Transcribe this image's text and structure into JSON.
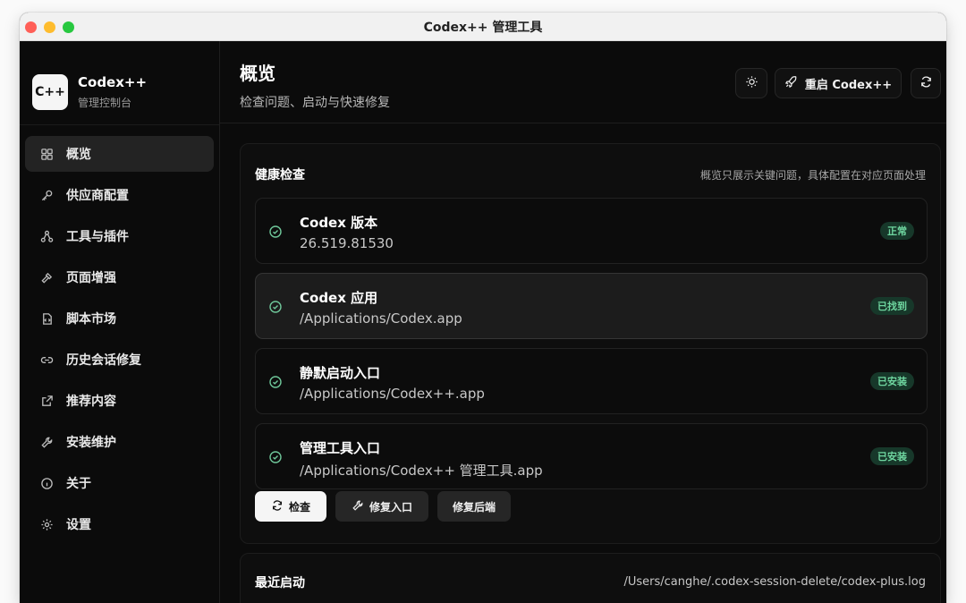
{
  "window": {
    "title": "Codex++ 管理工具"
  },
  "brand": {
    "logo_text": "C++",
    "name": "Codex++",
    "subtitle": "管理控制台"
  },
  "sidebar": {
    "items": [
      {
        "label": "概览",
        "icon": "grid-icon"
      },
      {
        "label": "供应商配置",
        "icon": "key-icon"
      },
      {
        "label": "工具与插件",
        "icon": "nodes-icon"
      },
      {
        "label": "页面增强",
        "icon": "hammer-icon"
      },
      {
        "label": "脚本市场",
        "icon": "script-icon"
      },
      {
        "label": "历史会话修复",
        "icon": "link-icon"
      },
      {
        "label": "推荐内容",
        "icon": "external-link-icon"
      },
      {
        "label": "安装维护",
        "icon": "wrench-icon"
      },
      {
        "label": "关于",
        "icon": "info-icon"
      },
      {
        "label": "设置",
        "icon": "gear-icon"
      }
    ]
  },
  "header": {
    "title": "概览",
    "subtitle": "检查问题、启动与快速修复",
    "restart_label": "重启 Codex++"
  },
  "health": {
    "title": "健康检查",
    "note": "概览只展示关键问题，具体配置在对应页面处理",
    "items": [
      {
        "name": "Codex 版本",
        "detail": "26.519.81530",
        "status": "正常"
      },
      {
        "name": "Codex 应用",
        "detail": "/Applications/Codex.app",
        "status": "已找到"
      },
      {
        "name": "静默启动入口",
        "detail": "/Applications/Codex++.app",
        "status": "已安装"
      },
      {
        "name": "管理工具入口",
        "detail": "/Applications/Codex++ 管理工具.app",
        "status": "已安装"
      }
    ],
    "actions": {
      "check": "检查",
      "fix_entry": "修复入口",
      "fix_backend": "修复后端"
    }
  },
  "recent": {
    "title": "最近启动",
    "log_path": "/Users/canghe/.codex-session-delete/codex-plus.log"
  },
  "colors": {
    "accent_green": "#6fd6a0",
    "badge_bg": "#17382a",
    "background": "#0b0b0b"
  }
}
